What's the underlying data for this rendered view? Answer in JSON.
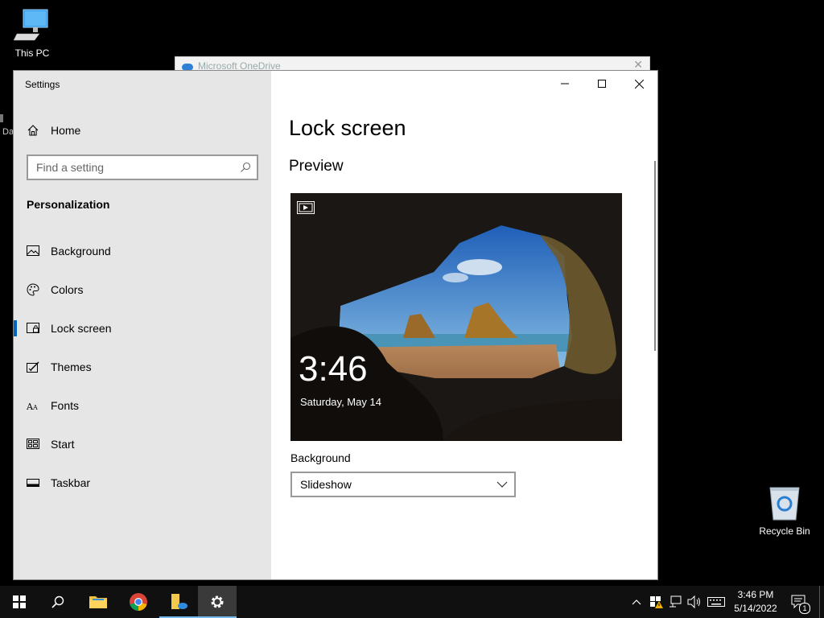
{
  "desktop": {
    "this_pc_label": "This PC",
    "partial_icon_label": "Da",
    "recycle_bin_label": "Recycle Bin"
  },
  "background_window": {
    "title": "Microsoft OneDrive"
  },
  "settings": {
    "app_title": "Settings",
    "home_label": "Home",
    "search_placeholder": "Find a setting",
    "section_title": "Personalization",
    "nav_items": [
      {
        "label": "Background",
        "icon": "picture-icon"
      },
      {
        "label": "Colors",
        "icon": "palette-icon"
      },
      {
        "label": "Lock screen",
        "icon": "lock-screen-icon",
        "active": true
      },
      {
        "label": "Themes",
        "icon": "themes-icon"
      },
      {
        "label": "Fonts",
        "icon": "fonts-icon"
      },
      {
        "label": "Start",
        "icon": "start-icon"
      },
      {
        "label": "Taskbar",
        "icon": "taskbar-icon"
      }
    ],
    "page_title": "Lock screen",
    "preview_title": "Preview",
    "preview": {
      "time": "3:46",
      "date": "Saturday, May 14"
    },
    "background_label": "Background",
    "background_value": "Slideshow"
  },
  "taskbar": {
    "time": "3:46 PM",
    "date": "5/14/2022",
    "notification_count": "1"
  },
  "colors": {
    "accent": "#0067c0",
    "sidebar_bg": "#e6e6e6",
    "taskbar_bg": "#101010"
  }
}
